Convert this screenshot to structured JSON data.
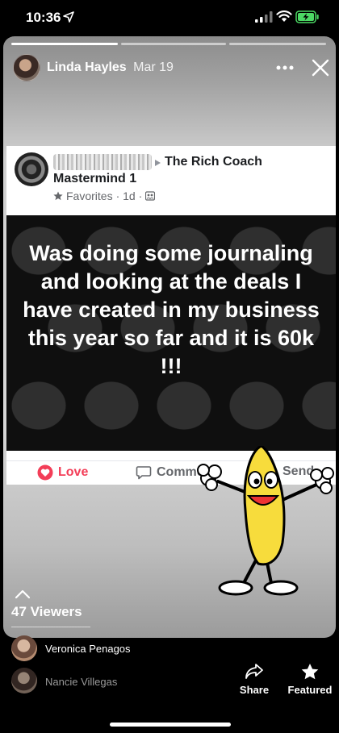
{
  "status_bar": {
    "time": "10:36",
    "icons": [
      "location-arrow-icon",
      "signal-icon",
      "wifi-icon",
      "battery-charging-icon"
    ],
    "battery_color": "#4cd964"
  },
  "story": {
    "author": "Linda Hayles",
    "date": "Mar 19",
    "progress_segments": 3,
    "active_segment": 1,
    "more_icon": "more-icon",
    "close_icon": "close-icon"
  },
  "post": {
    "group_name": "The Rich Coach",
    "group_line2": "Mastermind 1",
    "meta_favorites": "Favorites",
    "meta_time": "· 1d ·",
    "hero_text": "Was doing some journaling and looking at the deals I have created in my business this year so far and it is 60k !!!",
    "actions": {
      "love": "Love",
      "comment": "Comment",
      "send": "Send"
    },
    "love_color": "#f33e58"
  },
  "viewers": {
    "label": "47 Viewers",
    "list": [
      {
        "name": "Veronica Penagos"
      },
      {
        "name": "Nancie Villegas"
      }
    ]
  },
  "bottom_actions": {
    "share": "Share",
    "featured": "Featured"
  }
}
